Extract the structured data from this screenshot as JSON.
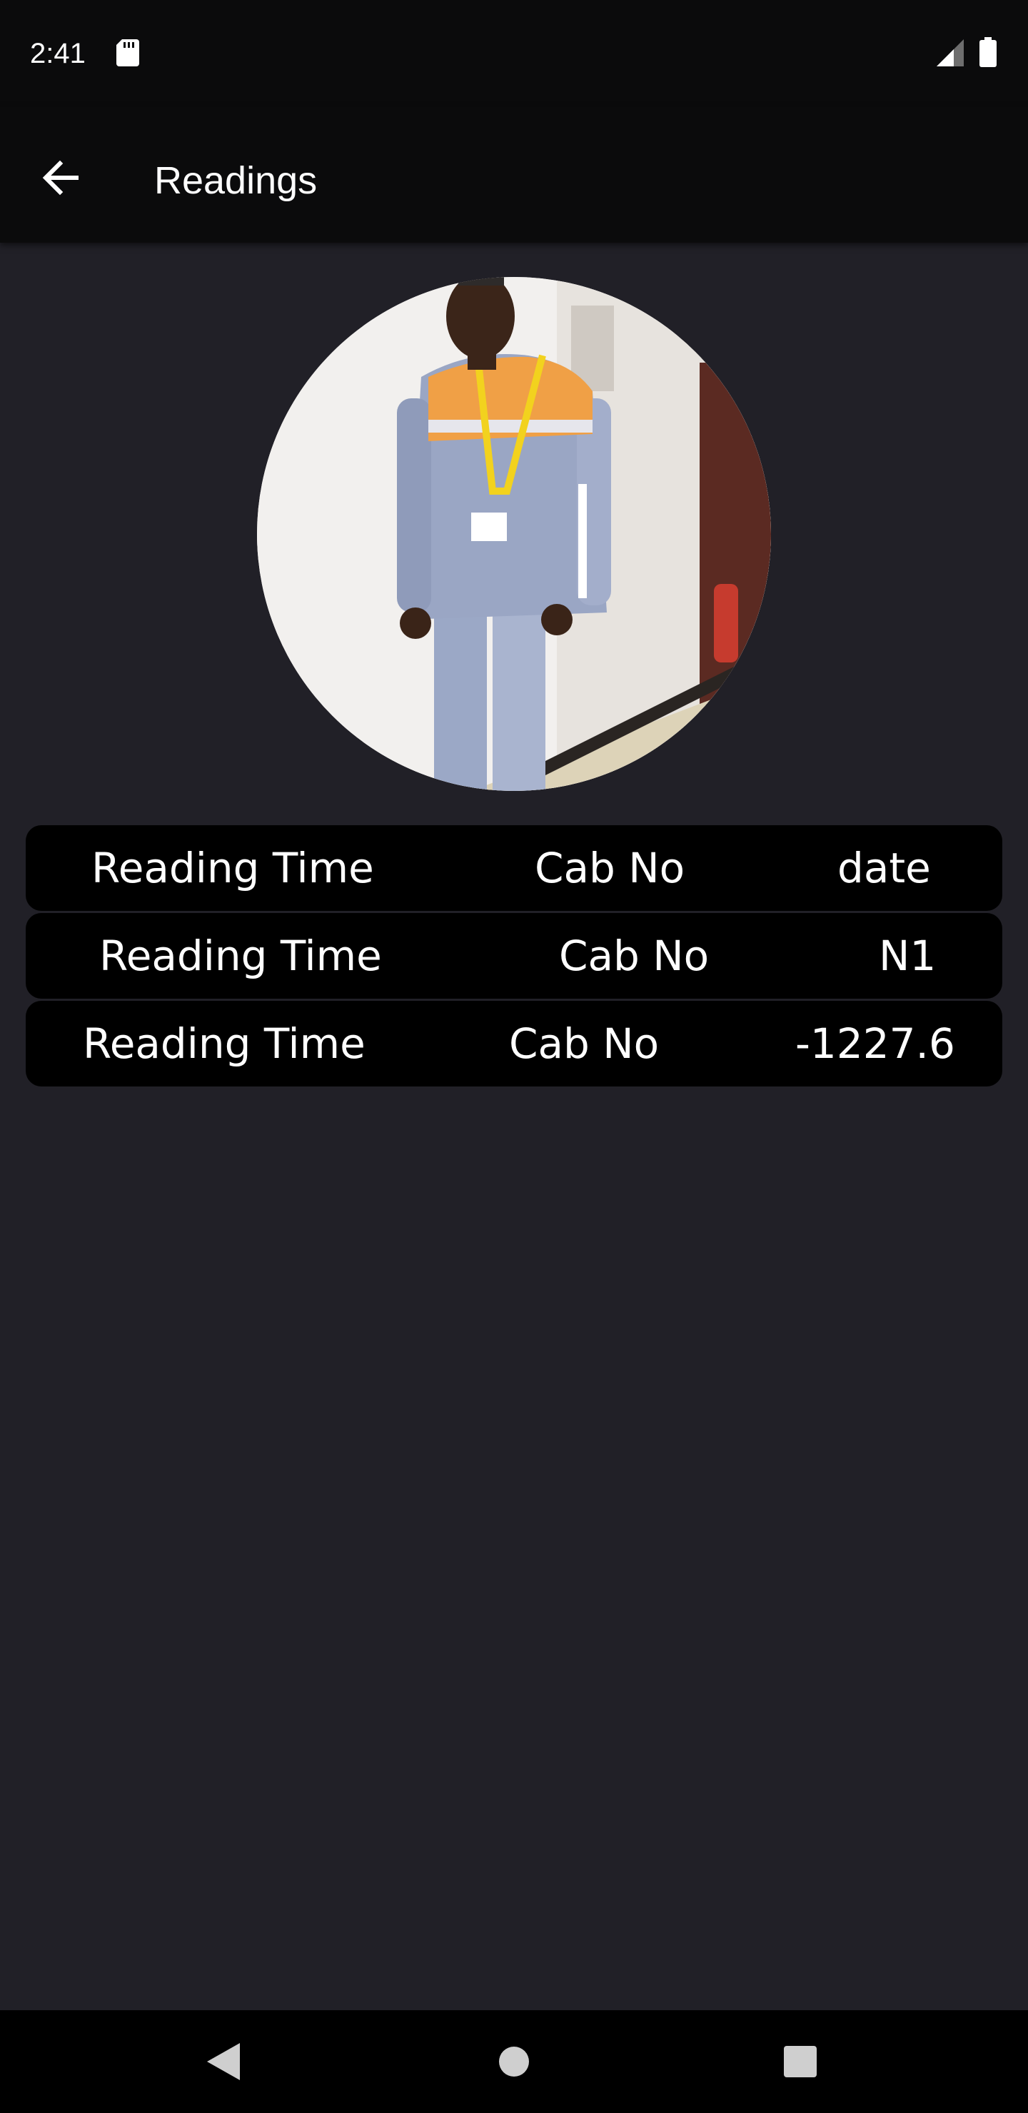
{
  "status_bar": {
    "time": "2:41",
    "icons": [
      "sd-card-icon",
      "signal-icon",
      "battery-icon"
    ]
  },
  "app_bar": {
    "title": "Readings",
    "back_icon": "arrow-back-icon"
  },
  "profile": {
    "avatar": "worker-photo"
  },
  "readings": [
    {
      "col1": "Reading Time",
      "col2": "Cab No",
      "col3": "date"
    },
    {
      "col1": "Reading Time",
      "col2": "Cab No",
      "col3": "N1"
    },
    {
      "col1": "Reading Time",
      "col2": "Cab No",
      "col3": "-1227.6"
    }
  ],
  "nav_bar": {
    "buttons": [
      "nav-back-icon",
      "nav-home-icon",
      "nav-recents-icon"
    ]
  },
  "colors": {
    "background": "#212027",
    "bars": "#0b0b0c",
    "card": "#000000",
    "text": "#ffffff"
  }
}
